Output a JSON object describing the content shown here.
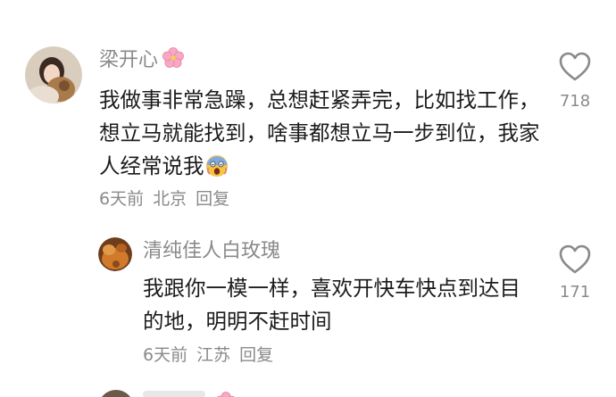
{
  "comments": [
    {
      "avatar_icon": "user-avatar-photo",
      "username": "梁开心",
      "username_badge_icon": "cherry-blossom-icon",
      "body": "我做事非常急躁，总想赶紧弄完，比如找工作，想立马就能找到，啥事都想立马一步到位，我家人经常说我",
      "body_emoji_icon": "scream-face-emoji-icon",
      "time": "6天前",
      "location": "北京",
      "reply_label": "回复",
      "likes": "718"
    },
    {
      "avatar_icon": "user-avatar-photo",
      "username": "清纯佳人白玫瑰",
      "body": "我跟你一模一样，喜欢开快车快点到达目的地，明明不赶时间",
      "time": "6天前",
      "location": "江苏",
      "reply_label": "回复",
      "likes": "171"
    }
  ],
  "colors": {
    "secondary_text": "#8a8a8a",
    "primary_text": "#1c1c1c",
    "like_icon": "#8a8a8a",
    "background": "#ffffff"
  },
  "icons": {
    "like": "heart-outline-icon"
  }
}
